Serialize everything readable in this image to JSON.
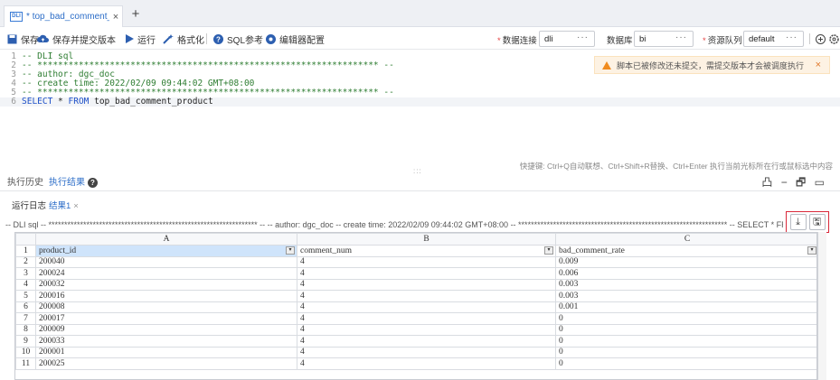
{
  "tab": {
    "icon": "DLI",
    "title_mark": "*",
    "title": "top_bad_comment_p",
    "close": "×",
    "plus": "+"
  },
  "toolbar": {
    "save": "保存",
    "save_submit": "保存并提交版本",
    "run": "运行",
    "format": "格式化",
    "sql_ref": "SQL参考",
    "editor_config": "编辑器配置",
    "data_conn_label": "数据连接",
    "data_conn_value": "dli",
    "database_label": "数据库",
    "database_value": "bi",
    "queue_label": "资源队列",
    "queue_value": "default",
    "dots": "···"
  },
  "editor": {
    "lines": [
      {
        "n": "1",
        "text": "-- DLI sql"
      },
      {
        "n": "2",
        "text": "-- ****************************************************************** --"
      },
      {
        "n": "3",
        "text": "-- author: dgc_doc"
      },
      {
        "n": "4",
        "text": "-- create time: 2022/02/09 09:44:02 GMT+08:00"
      },
      {
        "n": "5",
        "text": "-- ****************************************************************** --"
      }
    ],
    "line6_n": "6",
    "line6_kw1": "SELECT",
    "line6_mid": " * ",
    "line6_kw2": "FROM",
    "line6_rest": " top_bad_comment_product"
  },
  "warning": {
    "text": "脚本已被修改还未提交，需提交版本才会被调度执行",
    "close": "×"
  },
  "hint": "快捷键: Ctrl+Q自动联想、Ctrl+Shift+R替换、Ctrl+Enter 执行当前光标所在行或鼠标选中内容",
  "grip": ":::",
  "result_tabs": {
    "history": "执行历史",
    "results": "执行结果",
    "help": "?"
  },
  "result_icons": "凸 − 🗗 ▭",
  "sub_tabs": {
    "log": "运行日志",
    "result1": "结果1",
    "close": "×"
  },
  "sql_summary": "-- DLI sql -- ****************************************************************** -- -- author: dgc_doc -- create time: 2022/02/09 09:44:02 GMT+08:00 -- ****************************************************************** -- SELECT * FROM top_bad_comment_pr...",
  "download_icons": {
    "download": "⤓",
    "save": "🖫"
  },
  "grid": {
    "col_letters": [
      "A",
      "B",
      "C"
    ],
    "headers": [
      "product_id",
      "comment_num",
      "bad_comment_rate"
    ],
    "header_row_num": "1",
    "rows": [
      {
        "n": "2",
        "cells": [
          "200040",
          "4",
          "0.009"
        ]
      },
      {
        "n": "3",
        "cells": [
          "200024",
          "4",
          "0.006"
        ]
      },
      {
        "n": "4",
        "cells": [
          "200032",
          "4",
          "0.003"
        ]
      },
      {
        "n": "5",
        "cells": [
          "200016",
          "4",
          "0.003"
        ]
      },
      {
        "n": "6",
        "cells": [
          "200008",
          "4",
          "0.001"
        ]
      },
      {
        "n": "7",
        "cells": [
          "200017",
          "4",
          "0"
        ]
      },
      {
        "n": "8",
        "cells": [
          "200009",
          "4",
          "0"
        ]
      },
      {
        "n": "9",
        "cells": [
          "200033",
          "4",
          "0"
        ]
      },
      {
        "n": "10",
        "cells": [
          "200001",
          "4",
          "0"
        ]
      },
      {
        "n": "11",
        "cells": [
          "200025",
          "4",
          "0"
        ]
      }
    ]
  }
}
